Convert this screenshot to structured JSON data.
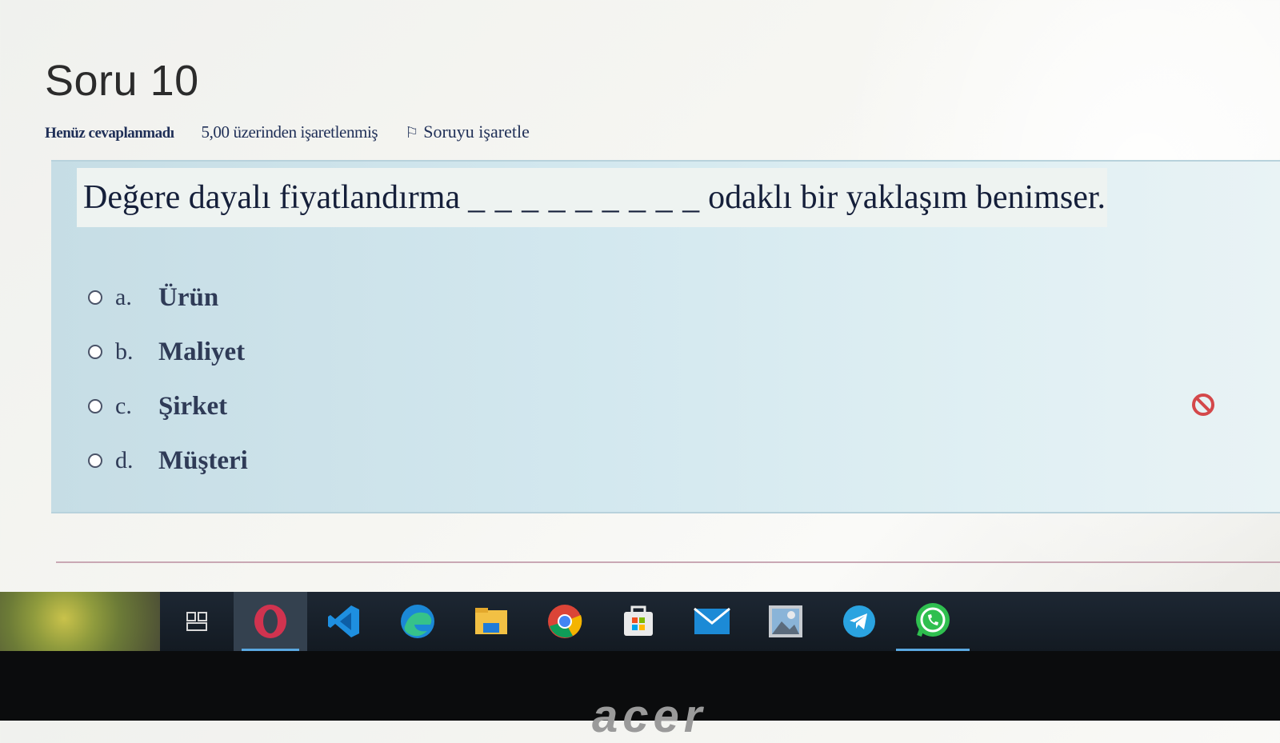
{
  "question": {
    "title": "Soru 10",
    "status": "Henüz cevaplanmadı",
    "grade": "5,00 üzerinden işaretlenmiş",
    "flag_label": "Soruyu işaretle",
    "flag_icon": "flag-icon",
    "text_before": "Değere dayalı fiyatlandırma",
    "blank": "_ _ _ _ _ _ _ _ _",
    "text_after": "odaklı bir yaklaşım benimser."
  },
  "options": [
    {
      "letter": "a.",
      "text": "Ürün"
    },
    {
      "letter": "b.",
      "text": "Maliyet"
    },
    {
      "letter": "c.",
      "text": "Şirket"
    },
    {
      "letter": "d.",
      "text": "Müşteri"
    }
  ],
  "taskbar": {
    "apps": [
      "task-view-icon",
      "opera-icon",
      "vscode-icon",
      "edge-icon",
      "file-explorer-icon",
      "chrome-icon",
      "store-icon",
      "mail-icon",
      "photos-icon",
      "telegram-icon",
      "whatsapp-icon"
    ]
  },
  "brand": "acer",
  "colors": {
    "accent": "#1f2f57",
    "question_bg": "#d3e8ef",
    "taskbar": "#1d2733",
    "warning": "#d4484a"
  }
}
